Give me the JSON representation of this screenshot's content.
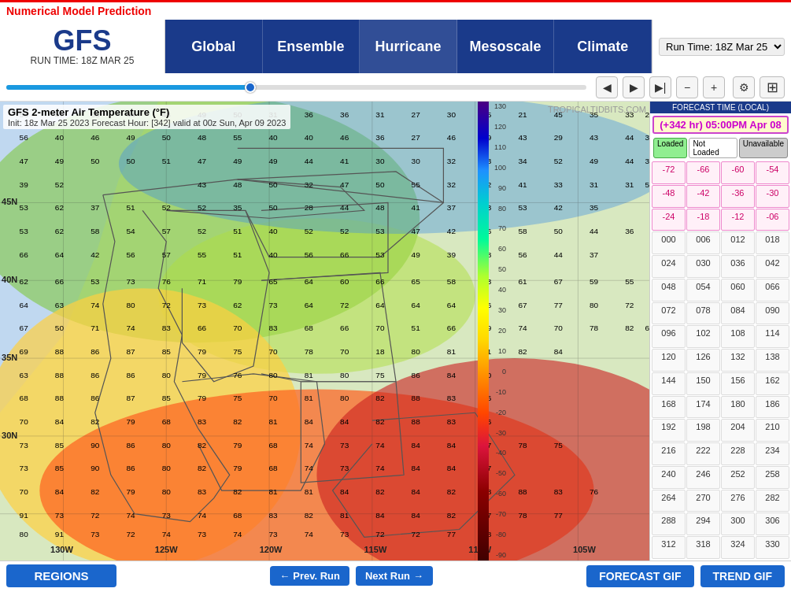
{
  "app": {
    "top_bar_title": "Numerical Model Prediction"
  },
  "header": {
    "model_name": "GFS",
    "run_time_label": "RUN TIME: 18Z MAR 25",
    "run_time_select": "Run Time: 18Z Mar 25",
    "nav_tabs": [
      {
        "id": "global",
        "label": "Global"
      },
      {
        "id": "ensemble",
        "label": "Ensemble"
      },
      {
        "id": "hurricane",
        "label": "Hurricane"
      },
      {
        "id": "mesoscale",
        "label": "Mesoscale"
      },
      {
        "id": "climate",
        "label": "Climate"
      }
    ]
  },
  "playback": {
    "prev_icon": "◀",
    "play_icon": "▶",
    "next_icon": "▶",
    "minus_icon": "−",
    "plus_icon": "+",
    "gear_icon": "⚙",
    "grid_icon": "⊞"
  },
  "map": {
    "title": "GFS 2-meter Air Temperature (°F)",
    "subtitle": "Init: 18z Mar 25 2023  Forecast Hour: [342]  valid at 00z Sun, Apr 09 2023",
    "watermark": "TROPICALTIDBITS.COM",
    "lat_labels": [
      "45N",
      "40N",
      "35N",
      "30N"
    ],
    "lon_labels": [
      "130W",
      "125W",
      "120W",
      "115W",
      "110W",
      "105W"
    ]
  },
  "forecast": {
    "header": "FORECAST TIME (LOCAL)",
    "active_label": "(+342 hr) 05:00PM Apr 08",
    "status_badges": [
      {
        "label": "Loaded",
        "type": "loaded"
      },
      {
        "label": "Not Loaded",
        "type": "not-loaded"
      },
      {
        "label": "Unavailable",
        "type": "unavailable"
      }
    ],
    "hours": [
      "-72",
      "-66",
      "-60",
      "-54",
      "-48",
      "-42",
      "-36",
      "-30",
      "-24",
      "-18",
      "-12",
      "-06",
      "000",
      "006",
      "012",
      "018",
      "024",
      "030",
      "036",
      "042",
      "048",
      "054",
      "060",
      "066",
      "072",
      "078",
      "084",
      "090",
      "096",
      "102",
      "108",
      "114",
      "120",
      "126",
      "132",
      "138",
      "144",
      "150",
      "156",
      "162",
      "168",
      "174",
      "180",
      "186",
      "192",
      "198",
      "204",
      "210",
      "216",
      "222",
      "228",
      "234",
      "240",
      "246",
      "252",
      "258",
      "264",
      "270",
      "276",
      "282",
      "288",
      "294",
      "300",
      "306",
      "312",
      "318",
      "324",
      "330"
    ],
    "active_hour": "342"
  },
  "bottom": {
    "regions_label": "REGIONS",
    "prev_run_label": "Prev. Run",
    "next_run_label": "Next Run",
    "forecast_gif_label": "FORECAST GIF",
    "trend_gif_label": "TREND GIF"
  },
  "scale": {
    "labels": [
      "130",
      "120",
      "110",
      "100",
      "90",
      "80",
      "70",
      "60",
      "50",
      "40",
      "30",
      "20",
      "10",
      "0",
      "-10",
      "-20",
      "-30",
      "-40",
      "-50",
      "-60",
      "-70",
      "-80",
      "-90"
    ]
  }
}
